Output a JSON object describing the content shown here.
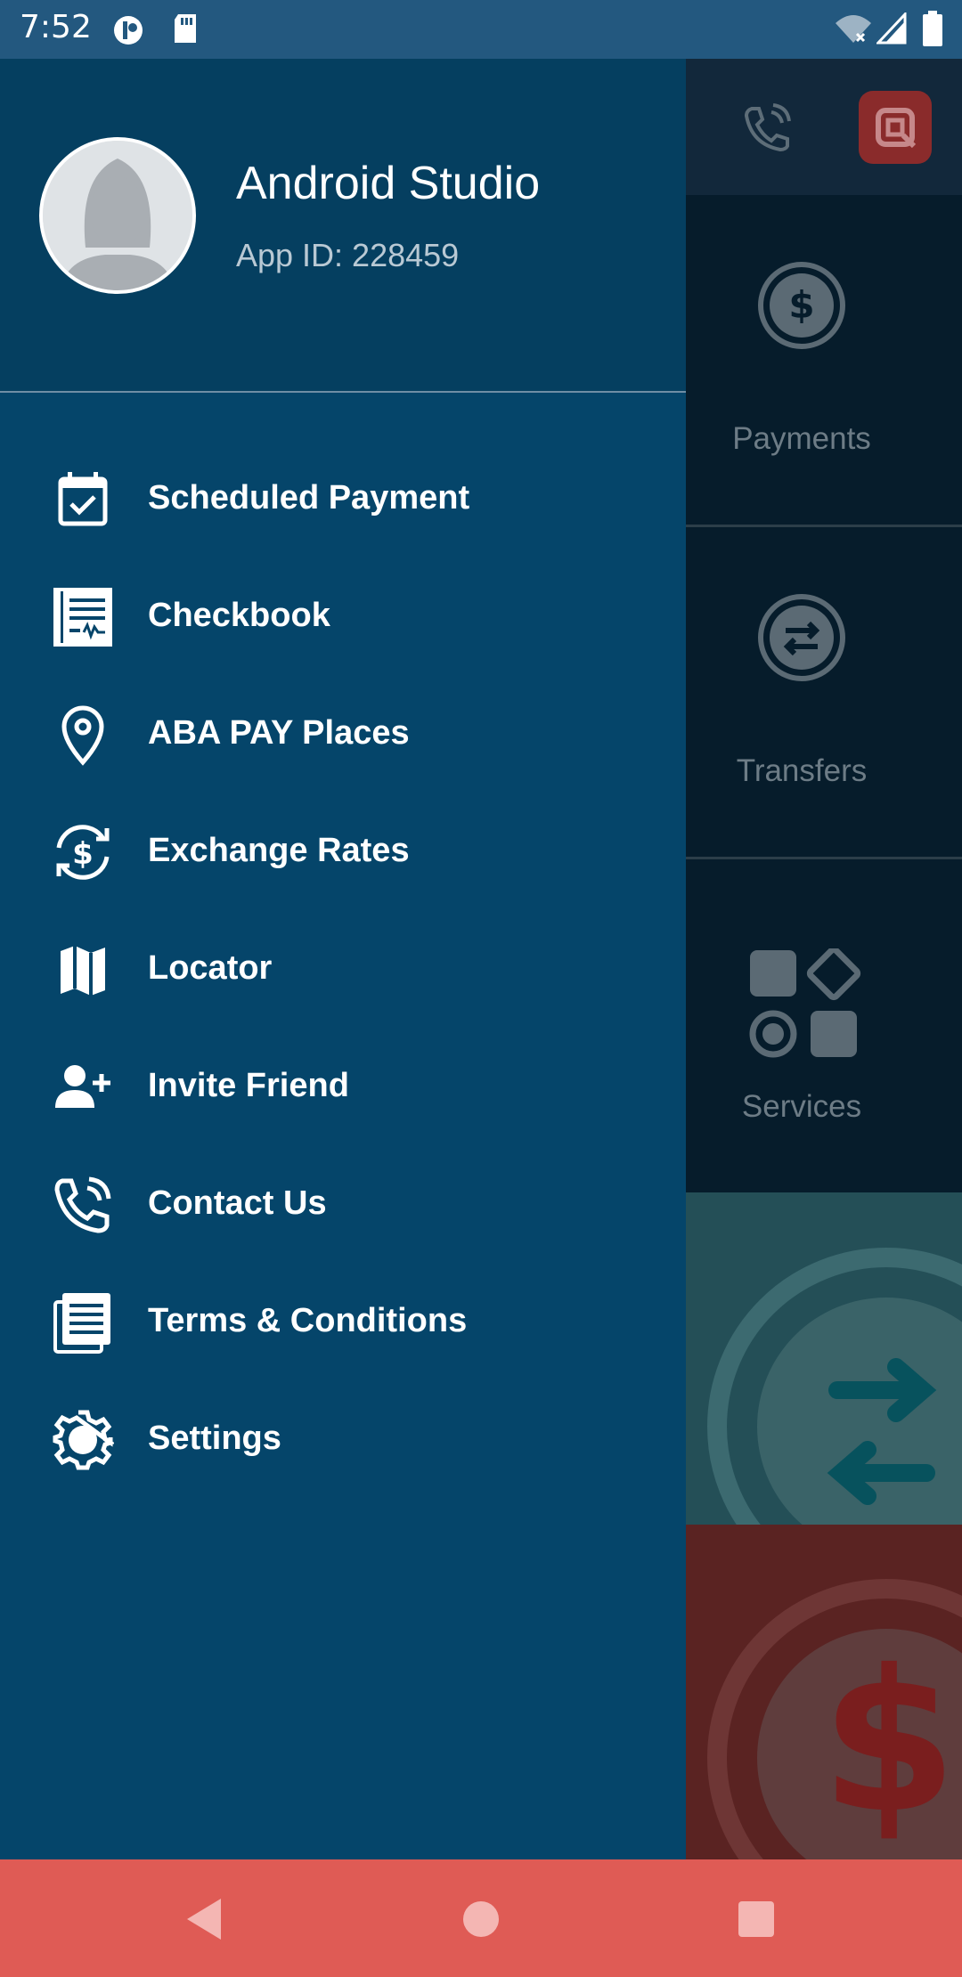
{
  "status_bar": {
    "time": "7:52",
    "icons": [
      "app-notification-icon",
      "sd-card-icon",
      "wifi-off-icon",
      "signal-icon",
      "battery-icon"
    ]
  },
  "profile": {
    "name": "Android Studio",
    "app_id": "App ID: 228459"
  },
  "menu": [
    {
      "label": "Scheduled Payment",
      "icon": "calendar-check-icon"
    },
    {
      "label": "Checkbook",
      "icon": "checkbook-icon"
    },
    {
      "label": "ABA PAY Places",
      "icon": "map-pin-icon"
    },
    {
      "label": "Exchange Rates",
      "icon": "currency-exchange-icon"
    },
    {
      "label": "Locator",
      "icon": "map-icon"
    },
    {
      "label": "Invite Friend",
      "icon": "add-user-icon"
    },
    {
      "label": "Contact Us",
      "icon": "phone-call-icon"
    },
    {
      "label": "Terms & Conditions",
      "icon": "document-icon"
    },
    {
      "label": "Settings",
      "icon": "gear-icon"
    }
  ],
  "background_app": {
    "tiles": [
      {
        "label": "Payments",
        "icon": "dollar-circle-icon"
      },
      {
        "label": "Transfers",
        "icon": "transfer-circle-icon"
      },
      {
        "label": "Services",
        "icon": "services-grid-icon"
      }
    ]
  },
  "colors": {
    "drawer": "#05456a",
    "status_bar": "#23587f",
    "nav_bar": "#df5b55"
  }
}
